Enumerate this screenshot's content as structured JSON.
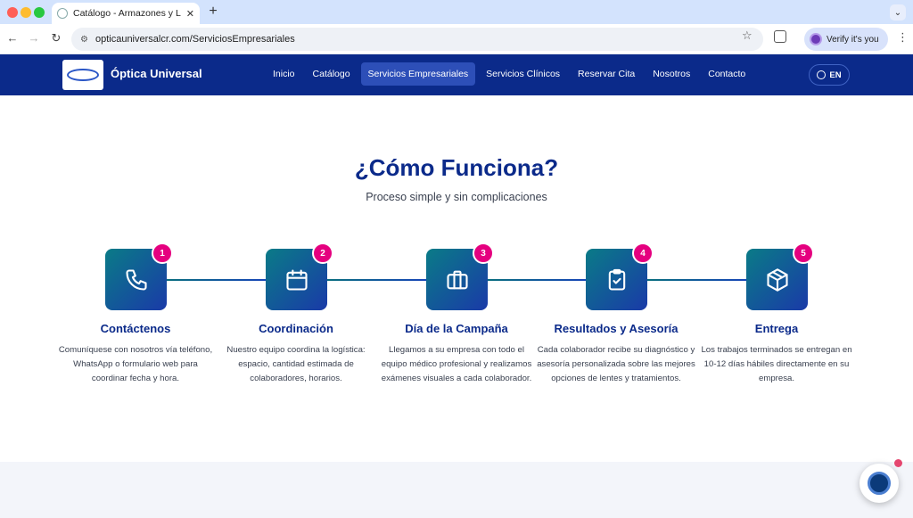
{
  "browser": {
    "tab_title": "Catálogo - Armazones y Lentes",
    "url": "opticauniversalcr.com/ServiciosEmpresariales",
    "verify_label": "Verify it's you"
  },
  "site": {
    "brand": "Óptica Universal",
    "nav": [
      {
        "label": "Inicio"
      },
      {
        "label": "Catálogo"
      },
      {
        "label": "Servicios Empresariales",
        "active": true
      },
      {
        "label": "Servicios Clínicos"
      },
      {
        "label": "Reservar Cita"
      },
      {
        "label": "Nosotros"
      },
      {
        "label": "Contacto"
      }
    ],
    "lang": "EN"
  },
  "section": {
    "title": "¿Cómo Funciona?",
    "subtitle": "Proceso simple y sin complicaciones",
    "steps": [
      {
        "number": "1",
        "icon": "phone-icon",
        "title": "Contáctenos",
        "desc": "Comuníquese con nosotros vía teléfono, WhatsApp o formulario web para coordinar fecha y hora."
      },
      {
        "number": "2",
        "icon": "calendar-icon",
        "title": "Coordinación",
        "desc": "Nuestro equipo coordina la logística: espacio, cantidad estimada de colaboradores, horarios."
      },
      {
        "number": "3",
        "icon": "briefcase-icon",
        "title": "Día de la Campaña",
        "desc": "Llegamos a su empresa con todo el equipo médico profesional y realizamos exámenes visuales a cada colaborador."
      },
      {
        "number": "4",
        "icon": "clipboard-check-icon",
        "title": "Resultados y Asesoría",
        "desc": "Cada colaborador recibe su diagnóstico y asesoría personalizada sobre las mejores opciones de lentes y tratamientos."
      },
      {
        "number": "5",
        "icon": "box-icon",
        "title": "Entrega",
        "desc": "Los trabajos terminados se entregan en 10-12 días hábiles directamente en su empresa."
      }
    ]
  },
  "colors": {
    "brand_blue": "#0b2a8a",
    "accent_pink": "#e5007f",
    "teal": "#0a7b87"
  }
}
